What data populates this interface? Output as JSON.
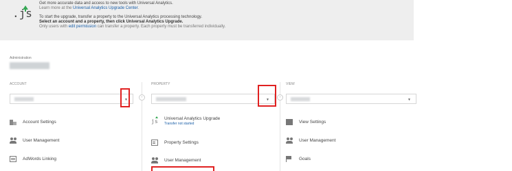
{
  "banner": {
    "line1": "Get more accurate data and access to new tools with Universal Analytics.",
    "line2_prefix": "Learn more at the ",
    "line2_link": "Universal Analytics Upgrade Center",
    "line2_suffix": ".",
    "line3": "To start the upgrade, transfer a property to the Universal Analytics processing technology.",
    "line4": "Select an account and a property, then click Universal Analytics Upgrade.",
    "line5_prefix": "Only users with ",
    "line5_link": "edit permission",
    "line5_suffix": " can transfer a property. Each property must be transferred individually.",
    "logo_text": ".js"
  },
  "admin": {
    "label": "Administration"
  },
  "columns": {
    "account": {
      "label": "ACCOUNT",
      "items": [
        {
          "label": "Account Settings",
          "icon": "building-icon"
        },
        {
          "label": "User Management",
          "icon": "users-icon"
        },
        {
          "label": "AdWords Linking",
          "icon": "adwords-link-icon"
        }
      ]
    },
    "property": {
      "label": "PROPERTY",
      "items": [
        {
          "label": "Universal Analytics Upgrade",
          "sub": "Transfer not started",
          "icon": "js-upgrade-icon"
        },
        {
          "label": "Property Settings",
          "icon": "property-settings-icon"
        },
        {
          "label": "User Management",
          "icon": "users-icon"
        }
      ]
    },
    "view": {
      "label": "VIEW",
      "items": [
        {
          "label": "View Settings",
          "icon": "page-icon"
        },
        {
          "label": "User Management",
          "icon": "users-icon"
        },
        {
          "label": "Goals",
          "icon": "flag-icon"
        }
      ]
    }
  },
  "colors": {
    "highlight": "#e02020",
    "link": "#1a5fa8",
    "banner_bg": "#eeeeee",
    "arrow": "#34a853"
  }
}
